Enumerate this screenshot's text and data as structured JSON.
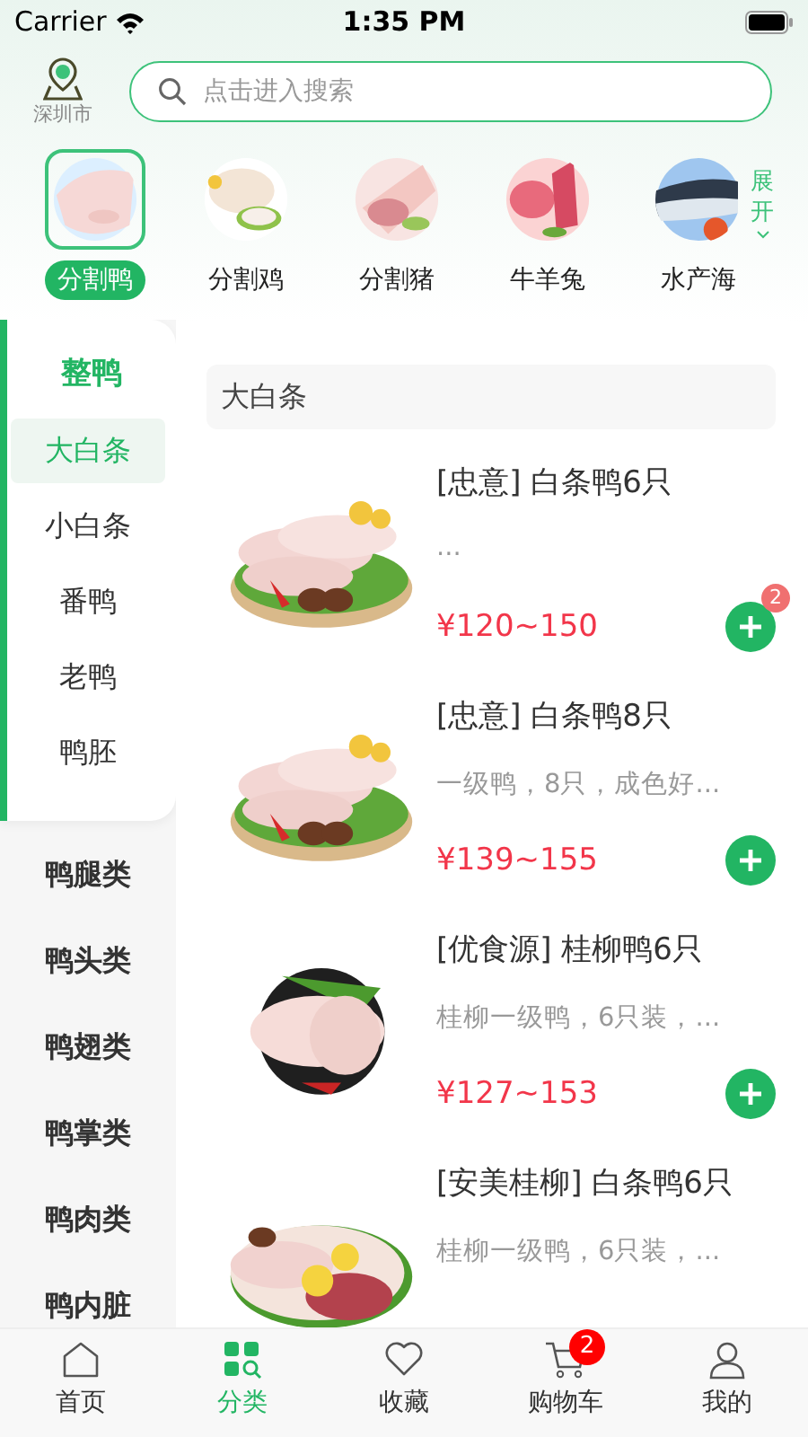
{
  "status_bar": {
    "carrier": "Carrier",
    "time": "1:35 PM"
  },
  "header": {
    "city": "深圳市",
    "search": {
      "placeholder": "点击进入搜索"
    }
  },
  "categories": [
    {
      "label": "分割鸭",
      "selected": true
    },
    {
      "label": "分割鸡",
      "selected": false
    },
    {
      "label": "分割猪",
      "selected": false
    },
    {
      "label": "牛羊兔",
      "selected": false
    },
    {
      "label": "水产海",
      "selected": false
    }
  ],
  "expand_button": "展开",
  "sidebar": [
    {
      "label": "整鸭",
      "expanded": true,
      "children": [
        {
          "label": "大白条",
          "selected": true
        },
        {
          "label": "小白条",
          "selected": false
        },
        {
          "label": "番鸭",
          "selected": false
        },
        {
          "label": "老鸭",
          "selected": false
        },
        {
          "label": "鸭胚",
          "selected": false
        }
      ]
    },
    {
      "label": "鸭腿类",
      "expanded": false
    },
    {
      "label": "鸭头类",
      "expanded": false
    },
    {
      "label": "鸭翅类",
      "expanded": false
    },
    {
      "label": "鸭掌类",
      "expanded": false
    },
    {
      "label": "鸭肉类",
      "expanded": false
    },
    {
      "label": "鸭内脏",
      "expanded": false
    }
  ],
  "section_title": "大白条",
  "products": [
    {
      "title": "[忠意] 白条鸭6只",
      "description": "...",
      "price": "¥120~150",
      "cart_count": "2"
    },
    {
      "title": "[忠意] 白条鸭8只",
      "description": "一级鸭，8只，成色好...",
      "price": "¥139~155"
    },
    {
      "title": "[优食源] 桂柳鸭6只",
      "description": "桂柳一级鸭，6只装，...",
      "price": "¥127~153"
    },
    {
      "title": "[安美桂柳] 白条鸭6只",
      "description": "桂柳一级鸭，6只装，..."
    }
  ],
  "tab_bar": [
    {
      "kind": "home",
      "label": "首页",
      "selected": false
    },
    {
      "kind": "category",
      "label": "分类",
      "selected": true
    },
    {
      "kind": "favorite",
      "label": "收藏",
      "selected": false
    },
    {
      "kind": "cart",
      "label": "购物车",
      "selected": false,
      "badge": "2"
    },
    {
      "kind": "profile",
      "label": "我的",
      "selected": false
    }
  ]
}
